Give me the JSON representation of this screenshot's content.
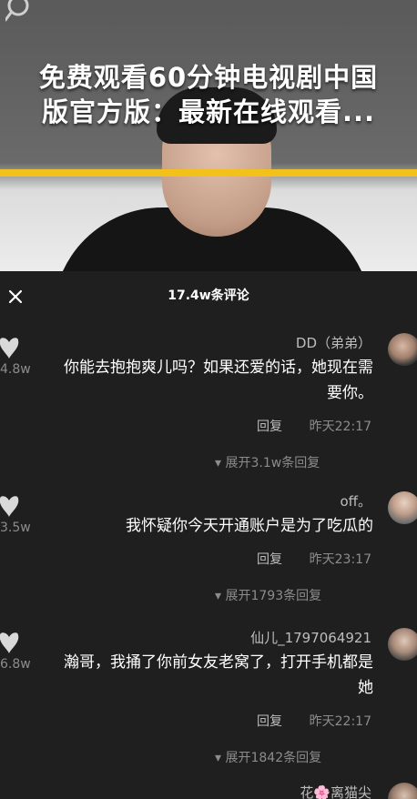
{
  "headline": {
    "line1": "免费观看60分钟电视剧中国",
    "line2": "版官方版：最新在线观看..."
  },
  "panel": {
    "comment_count_title": "17.4w条评论",
    "comments": [
      {
        "username": "DD（弟弟）",
        "text": "你能去抱抱爽儿吗？如果还爱的话，她现在需要你。",
        "time": "昨天22:17",
        "reply_label": "回复",
        "like_count": "4.8w",
        "expand_label": "展开3.1w条回复"
      },
      {
        "username": "off。",
        "text": "我怀疑你今天开通账户是为了吃瓜的",
        "time": "昨天23:17",
        "reply_label": "回复",
        "like_count": "3.5w",
        "expand_label": "展开1793条回复"
      },
      {
        "username": "仙儿_1797064921",
        "text": "瀚哥，我捅了你前女友老窝了，打开手机都是她",
        "time": "昨天22:17",
        "reply_label": "回复",
        "like_count": "6.8w",
        "expand_label": "展开1842条回复"
      },
      {
        "username": "花🌸离猫尖",
        "text": "",
        "time": "",
        "reply_label": "",
        "like_count": "",
        "expand_label": ""
      }
    ]
  },
  "colors": {
    "accent_yellow": "#f2c21a",
    "panel_bg": "#1f1f1f",
    "muted_text": "#8c8c8c"
  }
}
